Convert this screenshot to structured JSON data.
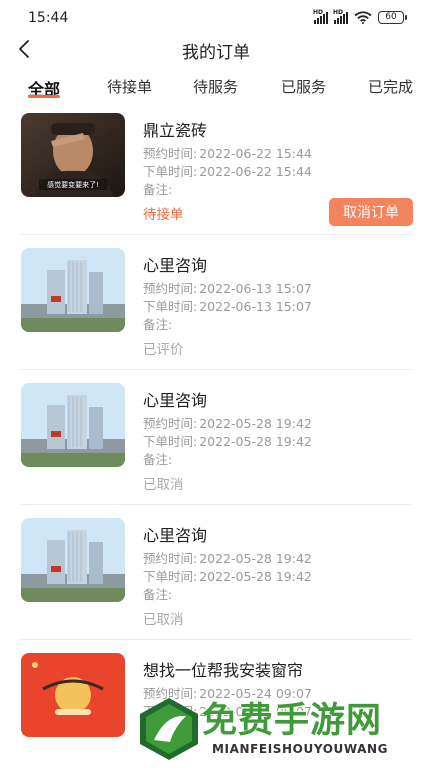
{
  "status_bar": {
    "time": "15:44",
    "battery": "60",
    "signal_tag": "HD"
  },
  "nav": {
    "title": "我的订单"
  },
  "tabs": [
    {
      "label": "全部",
      "active": true
    },
    {
      "label": "待接单",
      "active": false
    },
    {
      "label": "待服务",
      "active": false
    },
    {
      "label": "已服务",
      "active": false
    },
    {
      "label": "已完成",
      "active": false
    }
  ],
  "orders": [
    {
      "name": "鼎立瓷砖",
      "appointment_label": "预约时间:",
      "appointment_time": "2022-06-22 15:44",
      "order_label": "下单时间:",
      "order_time": "2022-06-22 15:44",
      "note_label": "备注:",
      "status": "待接单",
      "action": "取消订单",
      "thumb_caption": "感觉要变要来了!"
    },
    {
      "name": "心里咨询",
      "appointment_label": "预约时间:",
      "appointment_time": "2022-06-13 15:07",
      "order_label": "下单时间:",
      "order_time": "2022-06-13 15:07",
      "note_label": "备注:",
      "status": "已评价"
    },
    {
      "name": "心里咨询",
      "appointment_label": "预约时间:",
      "appointment_time": "2022-05-28 19:42",
      "order_label": "下单时间:",
      "order_time": "2022-05-28 19:42",
      "note_label": "备注:",
      "status": "已取消"
    },
    {
      "name": "心里咨询",
      "appointment_label": "预约时间:",
      "appointment_time": "2022-05-28 19:42",
      "order_label": "下单时间:",
      "order_time": "2022-05-28 19:42",
      "note_label": "备注:",
      "status": "已取消"
    },
    {
      "name": "想找一位帮我安装窗帘",
      "appointment_label": "预约时间:",
      "appointment_time": "2022-05-24 09:07",
      "order_label": "下单时间:",
      "order_time": "2022-05-24 09:07"
    }
  ],
  "watermark": {
    "cn": "免费手游网",
    "en": "MIANFEISHOUYOUWANG"
  },
  "colors": {
    "accent": "#f2693a",
    "button": "#f4835f",
    "muted": "#9a9a9a",
    "watermark_green": "#3f9b3a"
  }
}
